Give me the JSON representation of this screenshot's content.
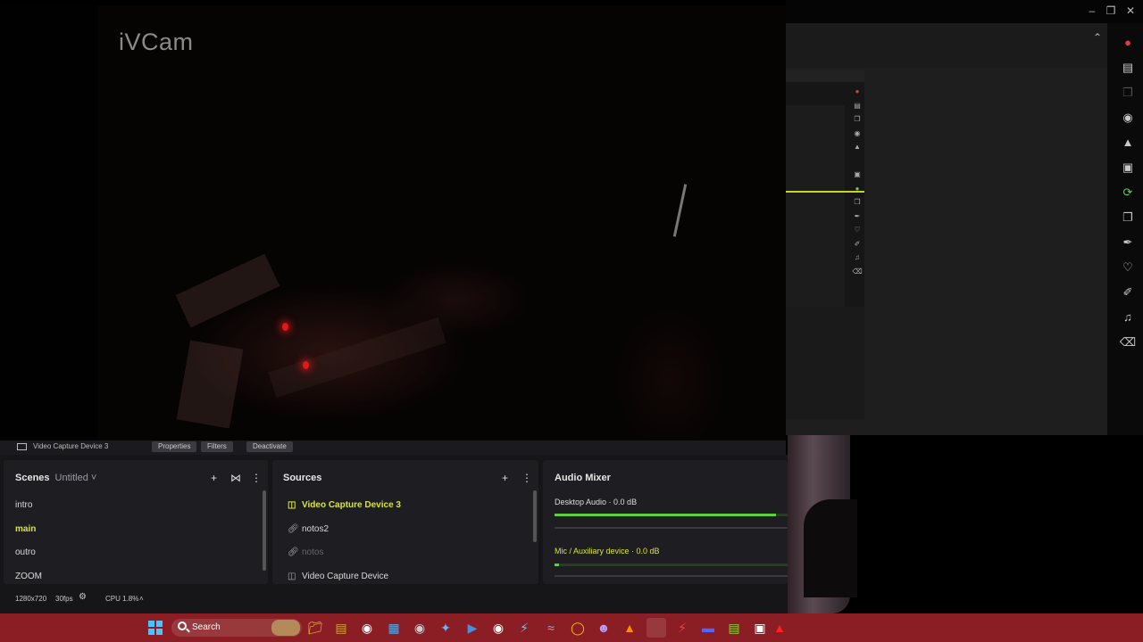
{
  "preview": {
    "brand_watermark": "iVCam"
  },
  "source_toolbar": {
    "current_source": "Video Capture Device 3",
    "properties_button": "Properties",
    "filters_button": "Filters",
    "deactivate_button": "Deactivate"
  },
  "scenes": {
    "title": "Scenes",
    "collection": "Untitled",
    "items": [
      "intro",
      "main",
      "outro",
      "ZOOM"
    ],
    "active": "main"
  },
  "sources": {
    "title": "Sources",
    "items": [
      {
        "label": "Video Capture Device 3",
        "icon": "camera-icon",
        "state": "selected"
      },
      {
        "label": "notos2",
        "icon": "link-icon",
        "state": "normal"
      },
      {
        "label": "notos",
        "icon": "link-icon",
        "state": "hidden"
      },
      {
        "label": "Video Capture Device",
        "icon": "camera-icon",
        "state": "normal"
      }
    ]
  },
  "audio_mixer": {
    "title": "Audio Mixer",
    "channels": [
      {
        "label": "Desktop Audio",
        "level": "0.0 dB",
        "meter_fraction": 0.95
      },
      {
        "label": "Mic / Auxiliary device",
        "level": "0.0 dB",
        "meter_fraction": 0.02
      }
    ]
  },
  "status_bar": {
    "resolution": "1280x720",
    "fps": "30fps",
    "cpu": "CPU 1.8%"
  },
  "taskbar": {
    "search_label": "Search"
  },
  "colors": {
    "accent_yellow": "#d8e240",
    "taskbar_red": "#8a1e24",
    "meter_green": "#5fcf3c"
  }
}
